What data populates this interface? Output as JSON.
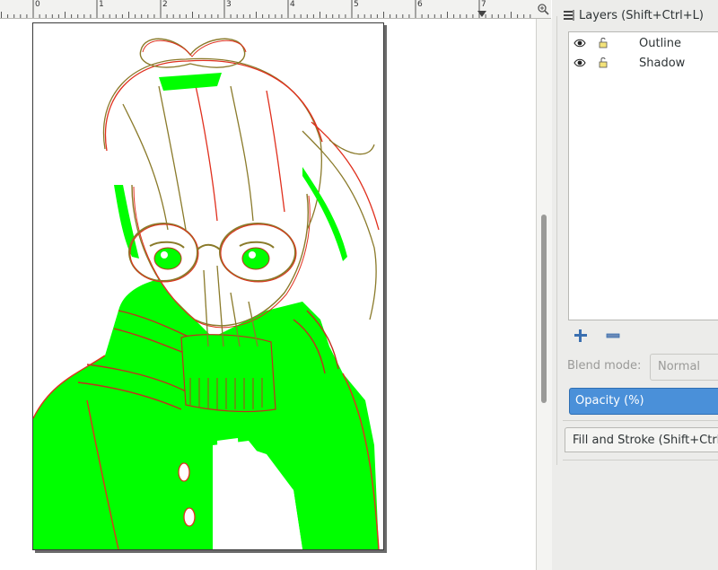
{
  "ruler": {
    "tick_labels": [
      "0",
      "1",
      "2",
      "3",
      "4",
      "5",
      "6",
      "7"
    ]
  },
  "canvas": {
    "page_background": "#ffffff",
    "artwork_colors": {
      "fill": "#00ff00",
      "stroke_outline": "#e0301e",
      "stroke_shadow": "#8a7a2a"
    }
  },
  "layers_panel": {
    "title": "Layers (Shift+Ctrl+L)",
    "icon": "layers-icon",
    "layers": [
      {
        "name": "Outline",
        "visible_icon": "eye-icon",
        "lock_icon": "unlocked-icon"
      },
      {
        "name": "Shadow",
        "visible_icon": "eye-icon",
        "lock_icon": "unlocked-icon"
      }
    ],
    "add_button_icon": "plus-icon",
    "remove_button_icon": "minus-icon",
    "blend_mode_label": "Blend mode:",
    "blend_mode_value": "Normal",
    "opacity_label": "Opacity (%)"
  },
  "fill_stroke_panel": {
    "title": "Fill and Stroke (Shift+Ctrl+F)",
    "icon": "fill-stroke-icon"
  },
  "colors": {
    "accent": "#4a90d9",
    "panel_bg": "#ececea"
  }
}
